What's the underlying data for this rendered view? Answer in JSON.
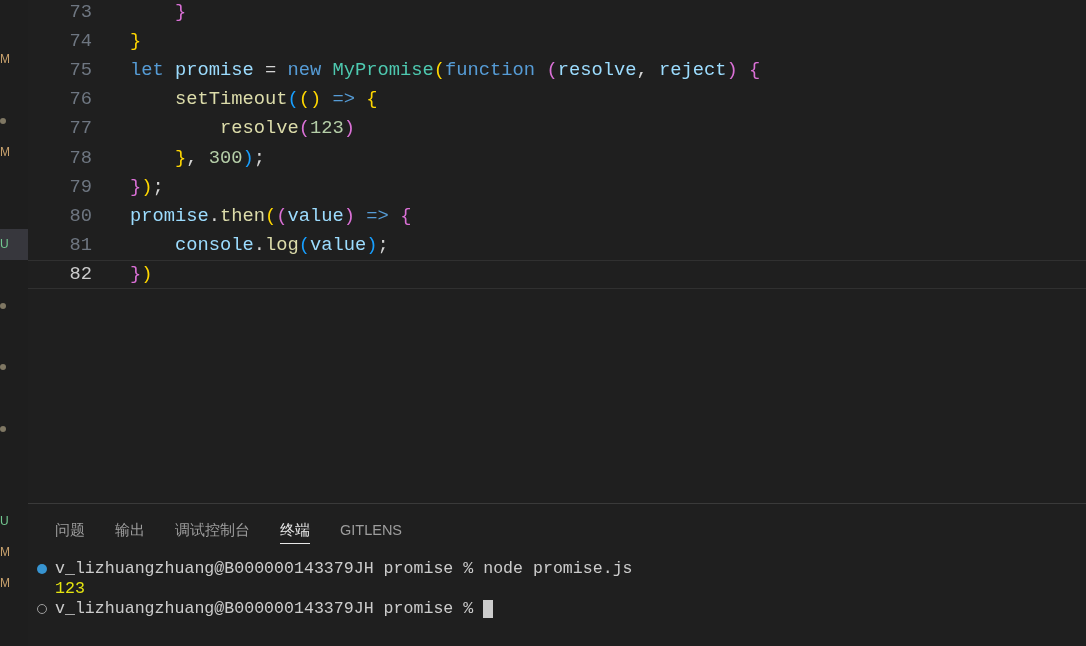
{
  "explorer_decorations": [
    {
      "kind": "modified",
      "text": "M",
      "selected": false
    },
    {
      "kind": "blank",
      "selected": false
    },
    {
      "kind": "dot",
      "selected": false
    },
    {
      "kind": "modified",
      "text": "M",
      "selected": false
    },
    {
      "kind": "blank",
      "selected": false
    },
    {
      "kind": "blank",
      "selected": false
    },
    {
      "kind": "untracked",
      "text": "U",
      "selected": true
    },
    {
      "kind": "blank",
      "selected": false
    },
    {
      "kind": "dot",
      "selected": false
    },
    {
      "kind": "blank",
      "selected": false
    },
    {
      "kind": "dot",
      "selected": false
    },
    {
      "kind": "blank",
      "selected": false
    },
    {
      "kind": "dot",
      "selected": false
    },
    {
      "kind": "blank",
      "selected": false
    },
    {
      "kind": "blank",
      "selected": false
    },
    {
      "kind": "untracked",
      "text": "U",
      "selected": false
    },
    {
      "kind": "modified",
      "text": "M",
      "selected": false
    },
    {
      "kind": "modified",
      "text": "M",
      "selected": false
    }
  ],
  "editor": {
    "lines": [
      {
        "number": "73",
        "current": false,
        "tokens": [
          {
            "text": "    }",
            "kind": "bracket2"
          }
        ]
      },
      {
        "number": "74",
        "current": false,
        "tokens": [
          {
            "text": "}",
            "kind": "bracket1"
          }
        ]
      },
      {
        "number": "75",
        "current": false,
        "tokens": [
          {
            "text": "let ",
            "kind": "keyword"
          },
          {
            "text": "promise ",
            "kind": "variable"
          },
          {
            "text": "= ",
            "kind": "plain"
          },
          {
            "text": "new ",
            "kind": "keyword"
          },
          {
            "text": "MyPromise",
            "kind": "class"
          },
          {
            "text": "(",
            "kind": "bracket1"
          },
          {
            "text": "function ",
            "kind": "keyword"
          },
          {
            "text": "(",
            "kind": "bracket2"
          },
          {
            "text": "resolve",
            "kind": "variable"
          },
          {
            "text": ", ",
            "kind": "plain"
          },
          {
            "text": "reject",
            "kind": "variable"
          },
          {
            "text": ") ",
            "kind": "bracket2"
          },
          {
            "text": "{",
            "kind": "bracket2"
          }
        ]
      },
      {
        "number": "76",
        "current": false,
        "tokens": [
          {
            "text": "    setTimeout",
            "kind": "function"
          },
          {
            "text": "(",
            "kind": "bracket3"
          },
          {
            "text": "() ",
            "kind": "bracket1"
          },
          {
            "text": "=> ",
            "kind": "keyword"
          },
          {
            "text": "{",
            "kind": "bracket1"
          }
        ]
      },
      {
        "number": "77",
        "current": false,
        "tokens": [
          {
            "text": "        resolve",
            "kind": "function"
          },
          {
            "text": "(",
            "kind": "bracket2"
          },
          {
            "text": "123",
            "kind": "number"
          },
          {
            "text": ")",
            "kind": "bracket2"
          }
        ]
      },
      {
        "number": "78",
        "current": false,
        "tokens": [
          {
            "text": "    }",
            "kind": "bracket1"
          },
          {
            "text": ", ",
            "kind": "plain"
          },
          {
            "text": "300",
            "kind": "number"
          },
          {
            "text": ")",
            "kind": "bracket3"
          },
          {
            "text": ";",
            "kind": "plain"
          }
        ]
      },
      {
        "number": "79",
        "current": false,
        "tokens": [
          {
            "text": "}",
            "kind": "bracket2"
          },
          {
            "text": ")",
            "kind": "bracket1"
          },
          {
            "text": ";",
            "kind": "plain"
          }
        ]
      },
      {
        "number": "80",
        "current": false,
        "tokens": [
          {
            "text": "promise",
            "kind": "variable"
          },
          {
            "text": ".",
            "kind": "plain"
          },
          {
            "text": "then",
            "kind": "function"
          },
          {
            "text": "(",
            "kind": "bracket1"
          },
          {
            "text": "(",
            "kind": "bracket2"
          },
          {
            "text": "value",
            "kind": "variable"
          },
          {
            "text": ") ",
            "kind": "bracket2"
          },
          {
            "text": "=> ",
            "kind": "keyword"
          },
          {
            "text": "{",
            "kind": "bracket2"
          }
        ]
      },
      {
        "number": "81",
        "current": false,
        "tokens": [
          {
            "text": "    console",
            "kind": "variable"
          },
          {
            "text": ".",
            "kind": "plain"
          },
          {
            "text": "log",
            "kind": "function"
          },
          {
            "text": "(",
            "kind": "bracket3"
          },
          {
            "text": "value",
            "kind": "variable"
          },
          {
            "text": ")",
            "kind": "bracket3"
          },
          {
            "text": ";",
            "kind": "plain"
          }
        ]
      },
      {
        "number": "82",
        "current": true,
        "tokens": [
          {
            "text": "}",
            "kind": "bracket2"
          },
          {
            "text": ")",
            "kind": "bracket1"
          }
        ]
      }
    ]
  },
  "panel": {
    "tabs": [
      {
        "label": "问题",
        "selected": false
      },
      {
        "label": "输出",
        "selected": false
      },
      {
        "label": "调试控制台",
        "selected": false
      },
      {
        "label": "终端",
        "selected": true
      },
      {
        "label": "GITLENS",
        "selected": false
      }
    ],
    "terminal": [
      {
        "kind": "command",
        "succeeded": true,
        "text": "v_lizhuangzhuang@B000000143379JH promise % node promise.js"
      },
      {
        "kind": "output",
        "text": "123"
      },
      {
        "kind": "command",
        "succeeded": false,
        "text": "v_lizhuangzhuang@B000000143379JH promise %",
        "cursor": true
      }
    ]
  }
}
